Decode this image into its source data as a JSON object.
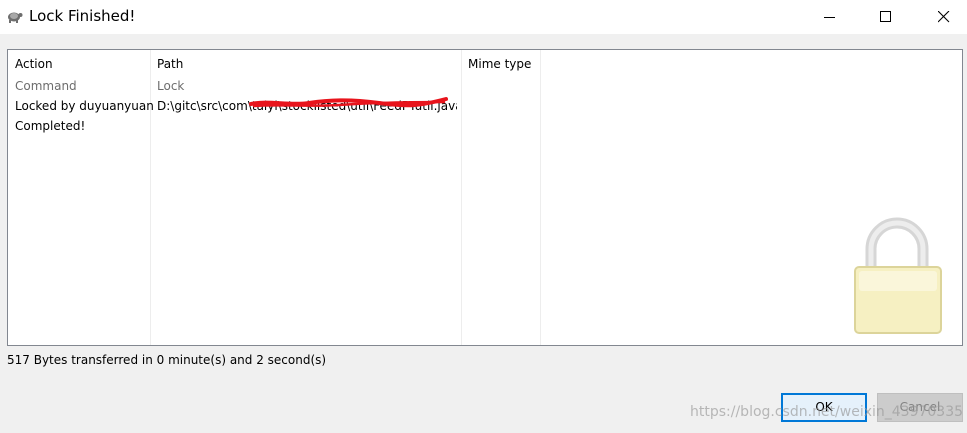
{
  "window": {
    "title": "Lock Finished!",
    "icons": {
      "app": "tortoise-icon",
      "minimize": "minimize-icon",
      "maximize": "maximize-icon",
      "close": "close-icon"
    }
  },
  "table": {
    "columns": [
      "Action",
      "Path",
      "Mime type"
    ],
    "rows": [
      {
        "action": "Command",
        "path": "Lock",
        "style": "gray"
      },
      {
        "action": "Locked by duyuanyuan",
        "path": "D:\\gitc\\src\\com\\taiyi\\stocklisted\\util\\FeedPTutil.java",
        "style": "normal"
      },
      {
        "action": "Completed!",
        "path": "",
        "style": "normal"
      }
    ]
  },
  "lock_overlay_icon": "padlock-icon",
  "status": "517 Bytes transferred in 0 minute(s) and 2 second(s)",
  "buttons": {
    "ok": "OK",
    "cancel": "Cancel"
  },
  "watermark": "https://blog.csdn.net/weixin_43970335",
  "colors": {
    "accent": "#0078d7",
    "redaction": "#e8141c"
  }
}
